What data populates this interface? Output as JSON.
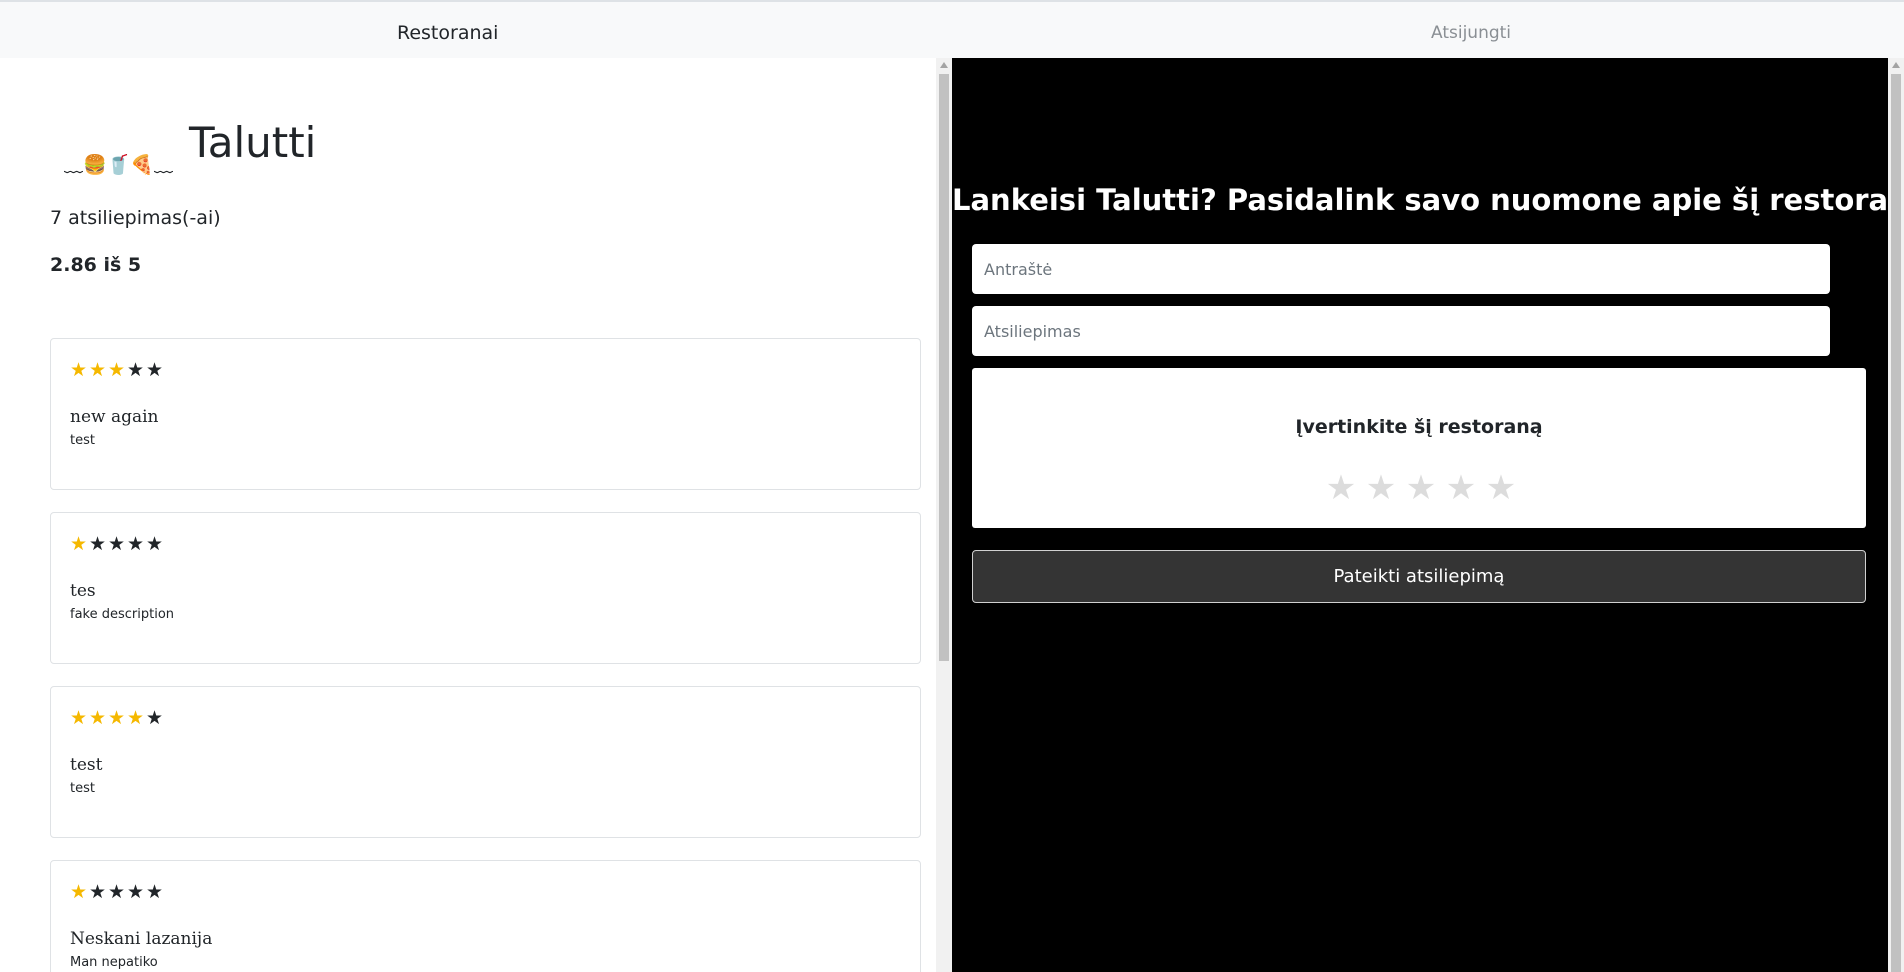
{
  "nav": {
    "brand": "Restoranai",
    "logout": "Atsijungti"
  },
  "restaurant": {
    "logo_text": "﹏🍔🥤🍕﹏",
    "name": "Talutti",
    "review_count": "7 atsiliepimas(-ai)",
    "average": "2.86 iš 5"
  },
  "reviews": [
    {
      "rating": 3,
      "stars": [
        "★",
        "★",
        "★",
        "★",
        "★"
      ],
      "title": "new again",
      "body": "test"
    },
    {
      "rating": 1,
      "stars": [
        "★",
        "★",
        "★",
        "★",
        "★"
      ],
      "title": "tes",
      "body": "fake description"
    },
    {
      "rating": 4,
      "stars": [
        "★",
        "★",
        "★",
        "★",
        "★"
      ],
      "title": "test",
      "body": "test"
    },
    {
      "rating": 1,
      "stars": [
        "★",
        "★",
        "★",
        "★",
        "★"
      ],
      "title": "Neskani lazanija",
      "body": "Man nepatiko"
    }
  ],
  "form": {
    "heading": "Lankeisi Talutti? Pasidalink savo nuomone apie šį restoraną",
    "title_placeholder": "Antraštė",
    "review_placeholder": "Atsiliepimas",
    "rating_label": "Įvertinkite šį restoraną",
    "rating_stars": [
      "★",
      "★",
      "★",
      "★",
      "★"
    ],
    "submit": "Pateikti atsiliepimą"
  },
  "colors": {
    "star_filled": "#f5b800",
    "star_empty": "#212529",
    "form_background": "#000000",
    "submit_background": "#343434"
  }
}
